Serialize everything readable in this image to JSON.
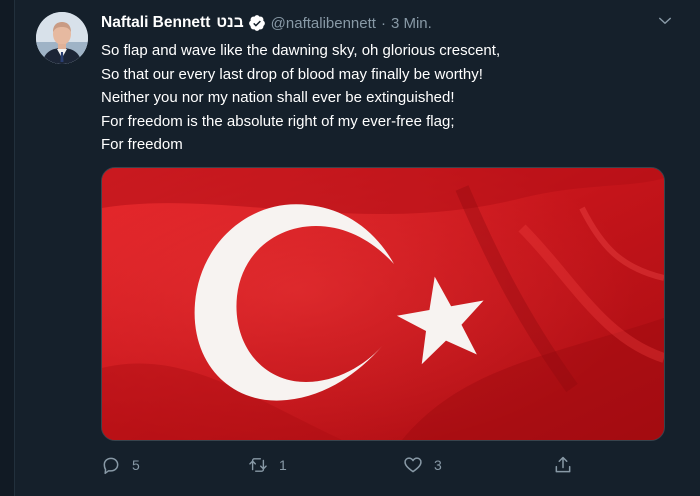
{
  "tweet": {
    "display_name": "Naftali Bennett",
    "hebrew_name": "בנט",
    "handle": "@naftalibennett",
    "separator": "·",
    "time": "3 Min.",
    "lines": [
      "So flap and wave like the dawning sky, oh glorious crescent,",
      "So that our every last drop of blood may finally be worthy!",
      "Neither you nor my nation shall ever be extinguished!",
      "For freedom is the absolute right of my ever-free flag;",
      "For freedom"
    ],
    "media": {
      "description_icon": "turkish-flag-image",
      "flag_color": "#d1191f",
      "emblem_color": "#ffffff"
    },
    "actions": {
      "reply": {
        "icon": "reply-icon",
        "count": "5"
      },
      "retweet": {
        "icon": "retweet-icon",
        "count": "1"
      },
      "like": {
        "icon": "heart-icon",
        "count": "3"
      },
      "share": {
        "icon": "share-icon"
      }
    },
    "verified_icon": "verified-badge-icon",
    "menu_icon": "chevron-down-icon"
  },
  "colors": {
    "background": "#15202b",
    "secondary_text": "#8899a6",
    "accent": "#1da1f2"
  }
}
